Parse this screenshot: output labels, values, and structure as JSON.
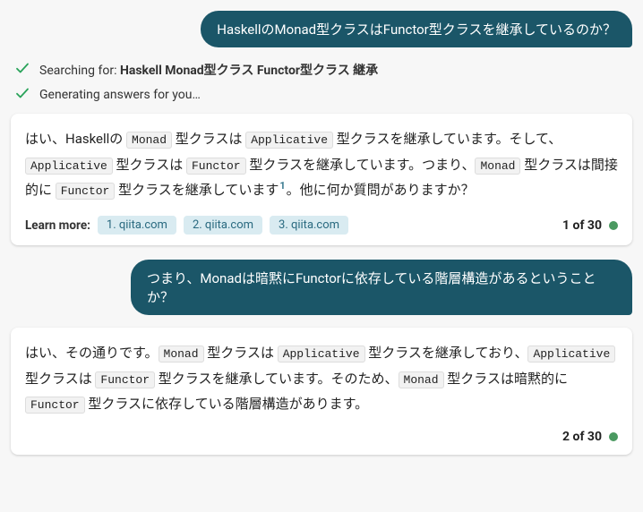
{
  "messages": [
    {
      "role": "user",
      "text": "HaskellのMonad型クラスはFunctor型クラスを継承しているのか？"
    }
  ],
  "status": {
    "searching_prefix": "Searching for: ",
    "searching_query": "Haskell Monad型クラス Functor型クラス 継承",
    "generating": "Generating answers for you…"
  },
  "response1": {
    "seg0": "はい、Haskellの ",
    "code0": "Monad",
    "seg1": " 型クラスは ",
    "code1": "Applicative",
    "seg2": " 型クラスを継承しています。そして、",
    "code2": "Applicative",
    "seg3": " 型クラスは ",
    "code3": "Functor",
    "seg4": " 型クラスを継承しています。つまり、",
    "code4": "Monad",
    "seg5": " 型クラスは間接的に ",
    "code5": "Functor",
    "seg6": " 型クラスを継承しています",
    "cite1": "1",
    "seg7": "。他に何か質問がありますか？",
    "learn_label": "Learn more:",
    "sources": [
      "1. qiita.com",
      "2. qiita.com",
      "3. qiita.com"
    ],
    "counter": "1 of 30"
  },
  "messages2": [
    {
      "role": "user",
      "text": "つまり、Monadは暗黙にFunctorに依存している階層構造があるということか？"
    }
  ],
  "response2": {
    "seg0": "はい、その通りです。",
    "code0": "Monad",
    "seg1": " 型クラスは ",
    "code1": "Applicative",
    "seg2": " 型クラスを継承しており、",
    "code2": "Applicative",
    "seg3": " 型クラスは ",
    "code3": "Functor",
    "seg4": " 型クラスを継承しています。そのため、",
    "code4": "Monad",
    "seg5": " 型クラスは暗黙的に ",
    "code5": "Functor",
    "seg6": " 型クラスに依存している階層構造があります。",
    "counter": "2 of 30"
  }
}
